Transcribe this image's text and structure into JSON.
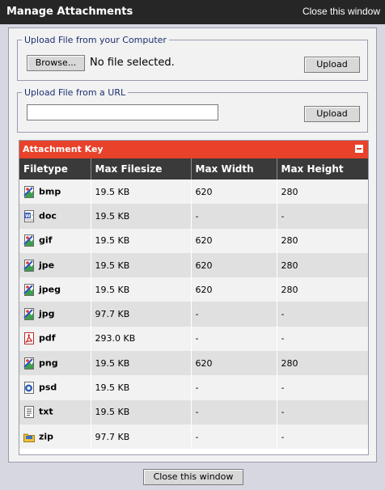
{
  "window": {
    "title": "Manage Attachments",
    "close_link": "Close this window"
  },
  "upload_computer": {
    "legend": "Upload File from your Computer",
    "browse_label": "Browse...",
    "file_status": "No file selected.",
    "upload_label": "Upload"
  },
  "upload_url": {
    "legend": "Upload File from a URL",
    "value": "",
    "upload_label": "Upload"
  },
  "attachment_key": {
    "title": "Attachment Key",
    "columns": [
      "Filetype",
      "Max Filesize",
      "Max Width",
      "Max Height"
    ],
    "rows": [
      {
        "type": "bmp",
        "icon": "image-file-icon",
        "size": "19.5 KB",
        "width": "620",
        "height": "280"
      },
      {
        "type": "doc",
        "icon": "word-doc-icon",
        "size": "19.5 KB",
        "width": "-",
        "height": "-"
      },
      {
        "type": "gif",
        "icon": "image-file-icon",
        "size": "19.5 KB",
        "width": "620",
        "height": "280"
      },
      {
        "type": "jpe",
        "icon": "image-file-icon",
        "size": "19.5 KB",
        "width": "620",
        "height": "280"
      },
      {
        "type": "jpeg",
        "icon": "image-file-icon",
        "size": "19.5 KB",
        "width": "620",
        "height": "280"
      },
      {
        "type": "jpg",
        "icon": "image-file-icon",
        "size": "97.7 KB",
        "width": "-",
        "height": "-"
      },
      {
        "type": "pdf",
        "icon": "pdf-file-icon",
        "size": "293.0 KB",
        "width": "-",
        "height": "-"
      },
      {
        "type": "png",
        "icon": "image-file-icon",
        "size": "19.5 KB",
        "width": "620",
        "height": "280"
      },
      {
        "type": "psd",
        "icon": "psd-file-icon",
        "size": "19.5 KB",
        "width": "-",
        "height": "-"
      },
      {
        "type": "txt",
        "icon": "text-file-icon",
        "size": "19.5 KB",
        "width": "-",
        "height": "-"
      },
      {
        "type": "zip",
        "icon": "zip-file-icon",
        "size": "97.7 KB",
        "width": "-",
        "height": "-"
      }
    ]
  },
  "footer": {
    "close_button": "Close this window"
  },
  "colors": {
    "titlebar": "#262626",
    "key_header": "#e8422a",
    "table_header": "#3a3a3a",
    "background": "#d6d7e0"
  }
}
